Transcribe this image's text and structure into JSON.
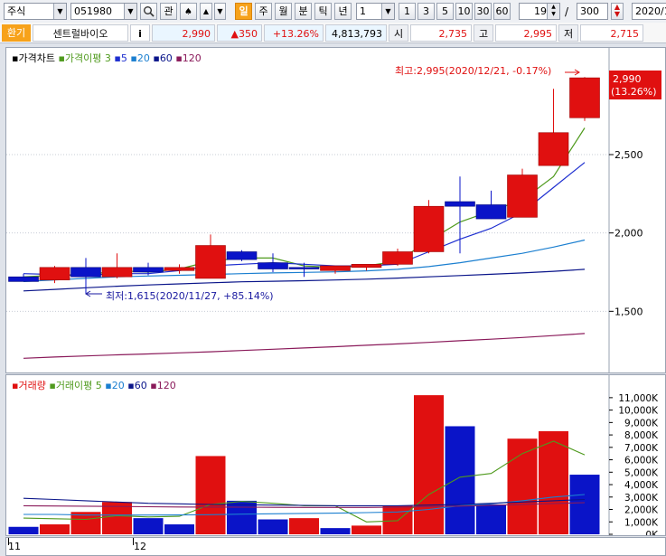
{
  "toolbar": {
    "market": "주식",
    "code": "051980",
    "gwan": "관",
    "active_period": "일",
    "periods": [
      "주",
      "월",
      "분",
      "틱",
      "년"
    ],
    "unit": "1",
    "nums": [
      "1",
      "3",
      "5",
      "10",
      "30",
      "60"
    ],
    "count_current": "19",
    "slash": "/",
    "count_total": "300",
    "date": "2020/1"
  },
  "quote": {
    "tag": "환기",
    "name": "센트럴바이오",
    "info": "i",
    "price": "2,990",
    "change": "▲350",
    "change_pct": "+13.26%",
    "volume": "4,813,793",
    "open_label": "시",
    "open": "2,735",
    "high_label": "고",
    "high": "2,995",
    "low_label": "저",
    "low": "2,715"
  },
  "price_legend": {
    "main": "가격차트",
    "ma_title": "가격이평",
    "ma": [
      "3",
      "5",
      "20",
      "60",
      "120"
    ]
  },
  "volume_legend": {
    "main": "거래량",
    "ma_title": "거래이평",
    "ma": [
      "5",
      "20",
      "60",
      "120"
    ]
  },
  "annotations": {
    "high": "최고:2,995(2020/12/21, -0.17%)",
    "low": "최저:1,615(2020/11/27, +85.14%)",
    "last_price": "2,990",
    "last_pct": "(13.26%)"
  },
  "x_labels": [
    "11",
    "12"
  ],
  "colors": {
    "up": "#e01010",
    "down": "#0a14c8",
    "ma3": "#4f9a1d",
    "ma5": "#1e2fd0",
    "ma20": "#1b7fd0",
    "ma60": "#0a158a",
    "ma120": "#8a1a5a"
  },
  "chart_data": [
    {
      "type": "candlestick",
      "title": "가격차트",
      "ylim": [
        1150,
        3100
      ],
      "yticks": [
        1500,
        2000,
        2500
      ],
      "ytick_labels": [
        "1,500",
        "2,000",
        "2,500"
      ],
      "candles": [
        {
          "o": 1720,
          "h": 1740,
          "l": 1690,
          "c": 1690
        },
        {
          "o": 1700,
          "h": 1790,
          "l": 1680,
          "c": 1780
        },
        {
          "o": 1780,
          "h": 1840,
          "l": 1615,
          "c": 1720
        },
        {
          "o": 1720,
          "h": 1870,
          "l": 1710,
          "c": 1780
        },
        {
          "o": 1780,
          "h": 1810,
          "l": 1730,
          "c": 1750
        },
        {
          "o": 1760,
          "h": 1800,
          "l": 1740,
          "c": 1780
        },
        {
          "o": 1710,
          "h": 1990,
          "l": 1710,
          "c": 1920
        },
        {
          "o": 1880,
          "h": 1890,
          "l": 1820,
          "c": 1830
        },
        {
          "o": 1810,
          "h": 1870,
          "l": 1750,
          "c": 1770
        },
        {
          "o": 1780,
          "h": 1810,
          "l": 1720,
          "c": 1770
        },
        {
          "o": 1760,
          "h": 1790,
          "l": 1740,
          "c": 1790
        },
        {
          "o": 1780,
          "h": 1800,
          "l": 1760,
          "c": 1800
        },
        {
          "o": 1800,
          "h": 1900,
          "l": 1790,
          "c": 1880
        },
        {
          "o": 1880,
          "h": 2210,
          "l": 1870,
          "c": 2170
        },
        {
          "o": 2200,
          "h": 2360,
          "l": 1870,
          "c": 2170
        },
        {
          "o": 2180,
          "h": 2270,
          "l": 2090,
          "c": 2090
        },
        {
          "o": 2100,
          "h": 2410,
          "l": 2100,
          "c": 2370
        },
        {
          "o": 2430,
          "h": 2920,
          "l": 2430,
          "c": 2640
        },
        {
          "o": 2735,
          "h": 2995,
          "l": 2715,
          "c": 2990
        }
      ],
      "series": [
        {
          "name": "3",
          "values": [
            1720,
            1730,
            1730,
            1760,
            1750,
            1770,
            1820,
            1840,
            1840,
            1790,
            1780,
            1790,
            1820,
            1950,
            2070,
            2140,
            2210,
            2360,
            2670
          ]
        },
        {
          "name": "5",
          "values": [
            1740,
            1735,
            1730,
            1740,
            1740,
            1760,
            1790,
            1800,
            1810,
            1800,
            1790,
            1790,
            1800,
            1880,
            1960,
            2030,
            2130,
            2290,
            2450
          ]
        },
        {
          "name": "20",
          "values": [
            1690,
            1700,
            1710,
            1720,
            1725,
            1730,
            1735,
            1740,
            1745,
            1748,
            1752,
            1758,
            1768,
            1785,
            1810,
            1840,
            1870,
            1910,
            1955
          ]
        },
        {
          "name": "60",
          "values": [
            1630,
            1640,
            1650,
            1660,
            1668,
            1675,
            1682,
            1688,
            1692,
            1695,
            1700,
            1705,
            1712,
            1720,
            1728,
            1736,
            1745,
            1755,
            1768
          ]
        },
        {
          "name": "120",
          "values": [
            1200,
            1208,
            1215,
            1222,
            1228,
            1235,
            1242,
            1250,
            1258,
            1266,
            1274,
            1283,
            1292,
            1302,
            1312,
            1322,
            1333,
            1345,
            1358
          ]
        }
      ]
    },
    {
      "type": "bar",
      "title": "거래량",
      "ylim": [
        0,
        11500
      ],
      "yticks": [
        0,
        1000,
        2000,
        3000,
        4000,
        5000,
        6000,
        7000,
        8000,
        9000,
        10000,
        11000
      ],
      "ytick_labels": [
        "0K",
        "1,000K",
        "2,000K",
        "3,000K",
        "4,000K",
        "5,000K",
        "6,000K",
        "7,000K",
        "8,000K",
        "9,000K",
        "10,000K",
        "11,000K"
      ],
      "values": [
        600,
        800,
        1800,
        2600,
        1300,
        800,
        6300,
        2700,
        1200,
        1300,
        500,
        700,
        2300,
        11200,
        8700,
        2400,
        7700,
        8300,
        4800
      ],
      "up": [
        false,
        true,
        true,
        true,
        false,
        false,
        true,
        false,
        false,
        true,
        false,
        true,
        true,
        true,
        false,
        false,
        true,
        true,
        false
      ],
      "series": [
        {
          "name": "5",
          "values": [
            1300,
            1250,
            1200,
            1500,
            1400,
            1450,
            2400,
            2650,
            2500,
            2300,
            2300,
            1000,
            1100,
            3200,
            4600,
            4900,
            6500,
            7500,
            6400
          ]
        },
        {
          "name": "20",
          "values": [
            1600,
            1600,
            1550,
            1550,
            1550,
            1560,
            1580,
            1620,
            1650,
            1680,
            1700,
            1750,
            1800,
            2000,
            2300,
            2450,
            2700,
            3000,
            3200
          ]
        },
        {
          "name": "60",
          "values": [
            2900,
            2800,
            2700,
            2600,
            2500,
            2450,
            2400,
            2380,
            2350,
            2330,
            2300,
            2300,
            2300,
            2350,
            2400,
            2500,
            2600,
            2700,
            2800
          ]
        },
        {
          "name": "120",
          "values": [
            2300,
            2280,
            2260,
            2240,
            2220,
            2200,
            2190,
            2180,
            2170,
            2160,
            2160,
            2160,
            2180,
            2220,
            2270,
            2330,
            2400,
            2480,
            2550
          ]
        }
      ]
    }
  ]
}
